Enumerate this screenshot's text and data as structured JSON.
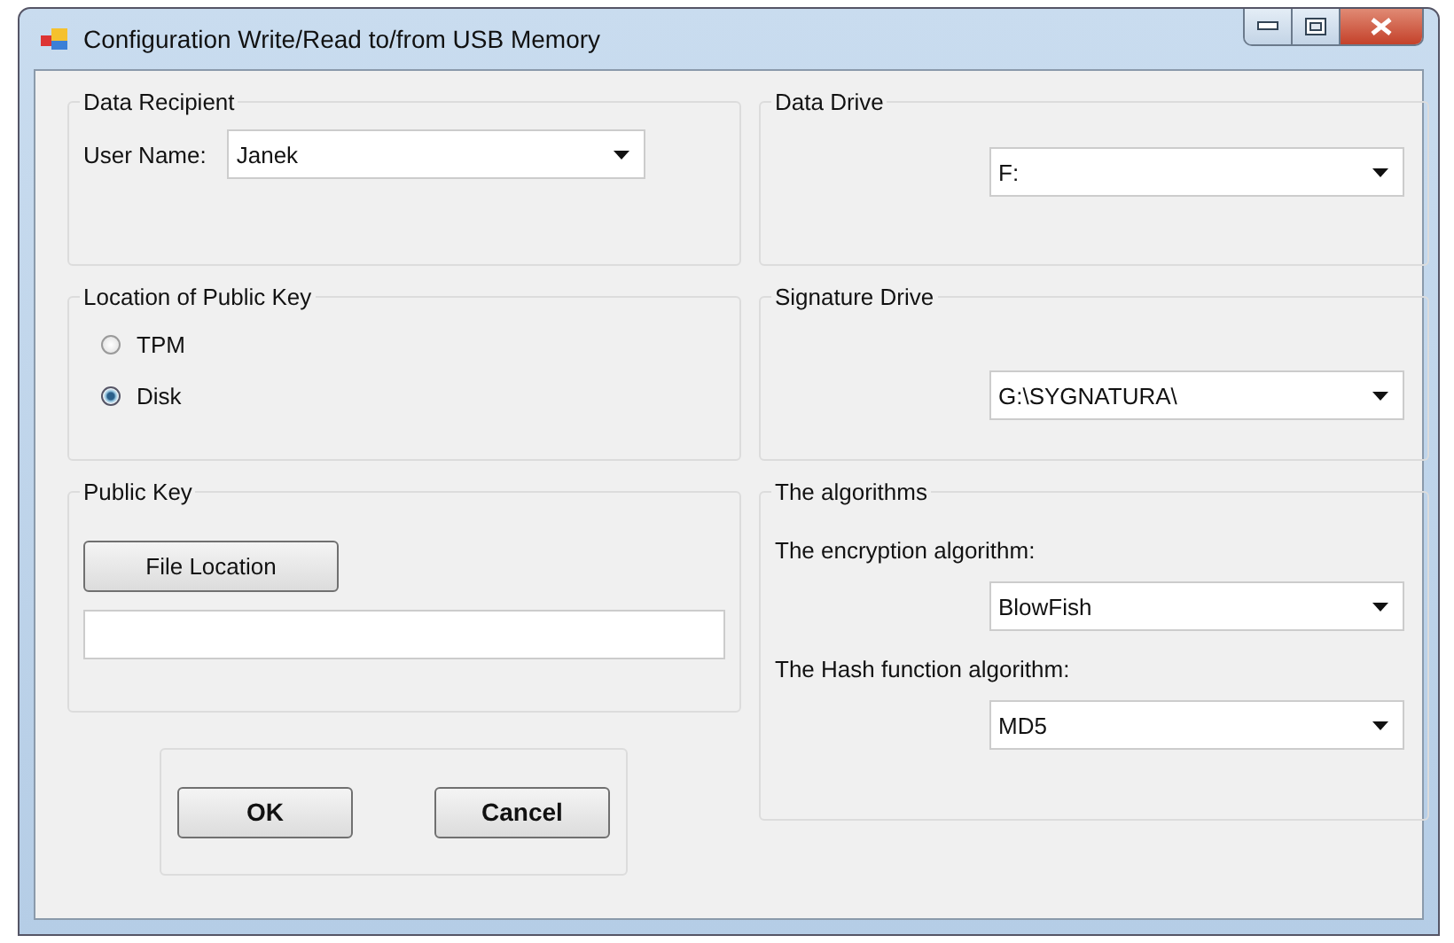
{
  "window": {
    "title": "Configuration Write/Read to/from USB Memory"
  },
  "data_recipient": {
    "title": "Data Recipient",
    "label": "User Name:",
    "value": "Janek"
  },
  "location": {
    "title": "Location of Public Key",
    "options": [
      {
        "label": "TPM",
        "selected": false
      },
      {
        "label": "Disk",
        "selected": true
      }
    ]
  },
  "public_key": {
    "title": "Public Key",
    "button": "File Location"
  },
  "buttons": [
    "OK",
    "Cancel"
  ],
  "data_drive": {
    "title": "Data Drive",
    "value": "F:"
  },
  "signature_drive": {
    "title": "Signature Drive",
    "value": "G:\\SYGNATURA\\"
  },
  "algorithms": {
    "title": "The algorithms",
    "fields": [
      {
        "label": "The encryption algorithm:",
        "value": "BlowFish"
      },
      {
        "label": "The Hash function algorithm:",
        "value": "MD5"
      }
    ]
  }
}
